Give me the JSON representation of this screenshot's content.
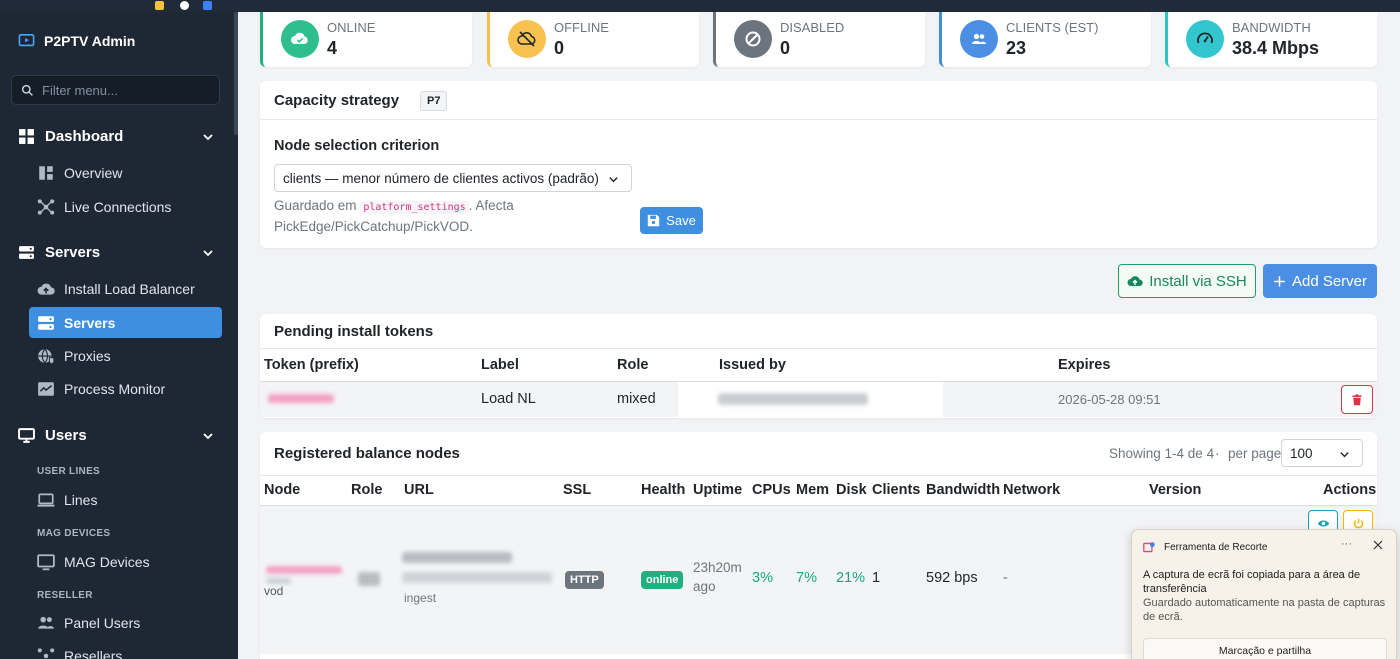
{
  "app": {
    "brand": "P2PTV Admin"
  },
  "sidebar": {
    "filter_placeholder": "Filter menu...",
    "sections": {
      "dashboard": "Dashboard",
      "servers": "Servers",
      "users": "Users"
    },
    "items": {
      "overview": "Overview",
      "live_connections": "Live Connections",
      "install_lb": "Install Load Balancer",
      "servers": "Servers",
      "proxies": "Proxies",
      "process_monitor": "Process Monitor",
      "lines": "Lines",
      "mag_devices": "MAG Devices",
      "panel_users": "Panel Users",
      "resellers": "Resellers"
    },
    "captions": {
      "user_lines": "USER LINES",
      "mag_devices": "MAG DEVICES",
      "reseller": "RESELLER"
    }
  },
  "stats": [
    {
      "label": "ONLINE",
      "value": "4",
      "color": "#20b07f",
      "circle": "#2fbf8f",
      "icon": "cloud-check-icon"
    },
    {
      "label": "OFFLINE",
      "value": "0",
      "color": "#f5c04d",
      "circle": "#f7c24f",
      "icon": "cloud-off-icon"
    },
    {
      "label": "DISABLED",
      "value": "0",
      "color": "#6c757d",
      "circle": "#6c757d",
      "icon": "ban-icon"
    },
    {
      "label": "CLIENTS (EST)",
      "value": "23",
      "color": "#3f8fe0",
      "circle": "#4a8fe3",
      "icon": "users-icon"
    },
    {
      "label": "BANDWIDTH",
      "value": "38.4 Mbps",
      "color": "#2cc6c6",
      "circle": "#34c6cf",
      "icon": "gauge-icon"
    }
  ],
  "capacity": {
    "title": "Capacity strategy",
    "badge": "P7",
    "criterion_label": "Node selection criterion",
    "criterion_value": "clients — menor número de clientes activos (padrão)",
    "help_prefix": "Guardado em ",
    "help_code": "platform_settings",
    "help_suffix": ". Afecta PickEdge/PickCatchup/PickVOD.",
    "save_label": "Save"
  },
  "actions": {
    "install_ssh": "Install via SSH",
    "add_server": "Add Server"
  },
  "tokens": {
    "title": "Pending install tokens",
    "columns": [
      "Token (prefix)",
      "Label",
      "Role",
      "Issued by",
      "Expires"
    ],
    "rows": [
      {
        "label": "Load NL",
        "role": "mixed",
        "expires": "2026-05-28 09:51"
      }
    ]
  },
  "nodes": {
    "title": "Registered balance nodes",
    "showing": "Showing 1-4 de 4",
    "sep": "·",
    "per_page_label": "per page",
    "per_page_value": "100",
    "columns": [
      "Node",
      "Role",
      "URL",
      "SSL",
      "Health",
      "Uptime",
      "CPUs",
      "Mem",
      "Disk",
      "Clients",
      "Bandwidth",
      "Network",
      "Version",
      "Actions"
    ],
    "row": {
      "role_sub": "vod",
      "url_sub": "ingest",
      "ssl": "HTTP",
      "health": "online",
      "uptime_1": "23h20m",
      "uptime_2": "ago",
      "cpus": "3%",
      "mem": "7%",
      "disk": "21%",
      "clients": "1",
      "bandwidth": "592 bps",
      "network": "-"
    }
  },
  "toast": {
    "app": "Ferramenta de Recorte",
    "more": "···",
    "message": "A captura de ecrã foi copiada para a área de transferência",
    "sub": "Guardado automaticamente na pasta de capturas de ecrã.",
    "button": "Marcação e partilha"
  }
}
